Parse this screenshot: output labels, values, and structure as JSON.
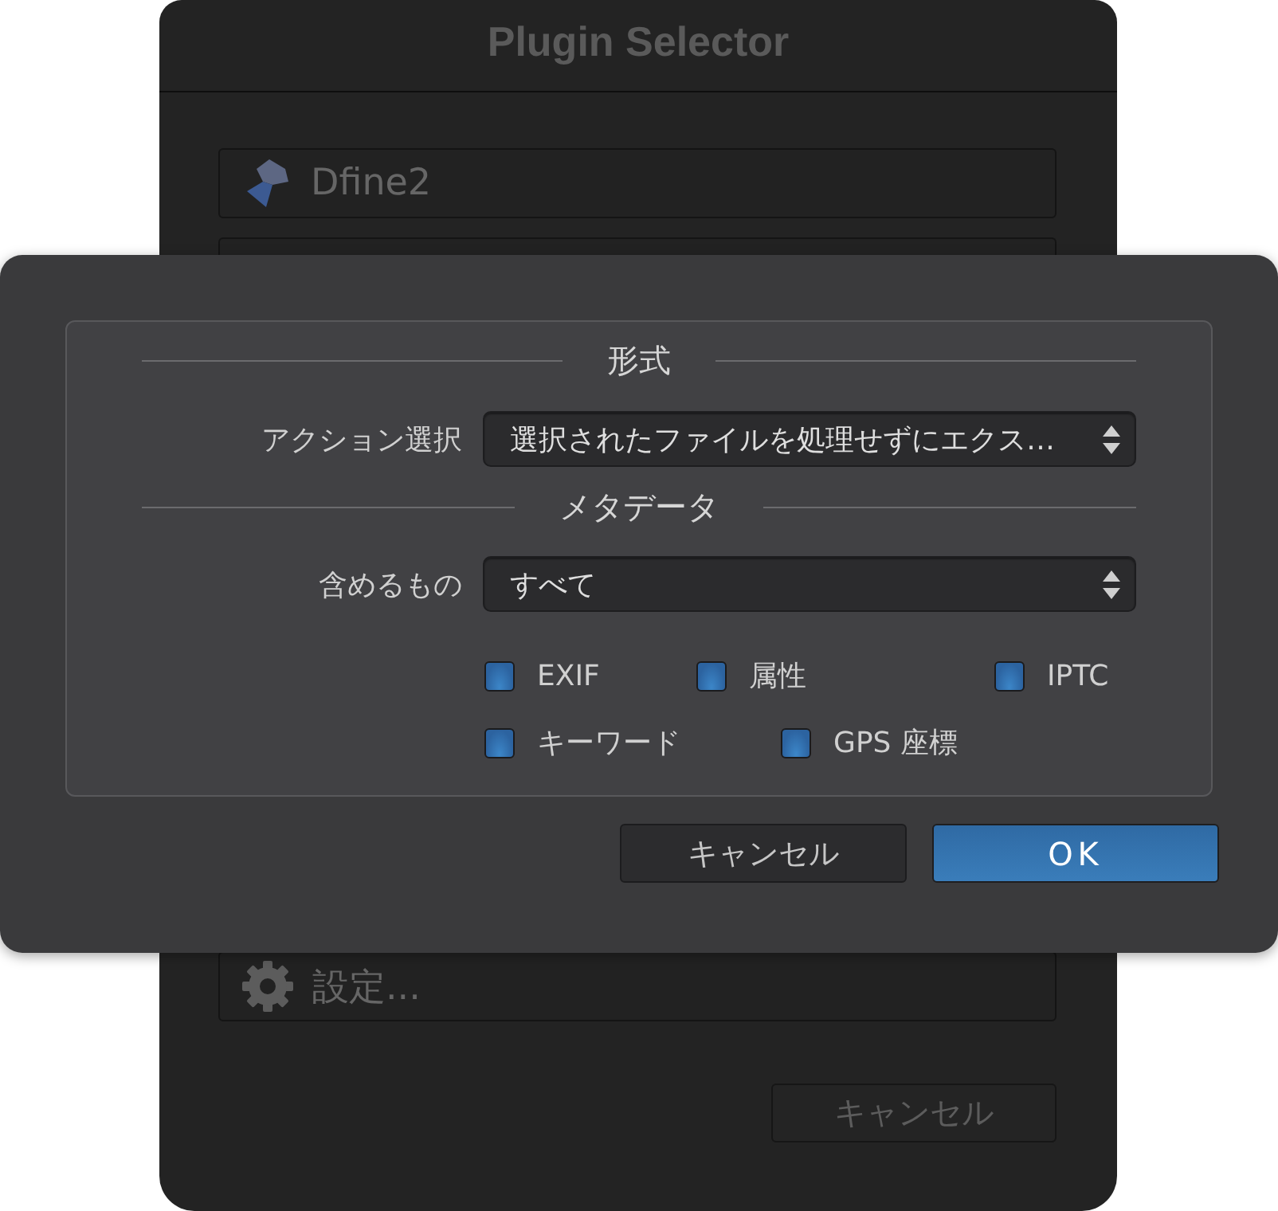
{
  "window": {
    "title": "Plugin Selector",
    "plugins": [
      {
        "name": "Dfine2"
      }
    ],
    "settings_item": {
      "label": "設定..."
    },
    "cancel_button": {
      "label": "キャンセル"
    }
  },
  "sheet": {
    "sections": [
      {
        "title": "形式",
        "fields": [
          {
            "label": "アクション選択",
            "value": "選択されたファイルを処理せずにエクス…"
          }
        ]
      },
      {
        "title": "メタデータ",
        "fields": [
          {
            "label": "含めるもの",
            "value": "すべて"
          }
        ],
        "checkbox_rows": [
          [
            {
              "label": "EXIF",
              "checked": true
            },
            {
              "label": "属性",
              "checked": true
            },
            {
              "label": "IPTC",
              "checked": true
            }
          ],
          [
            {
              "label": "キーワード",
              "checked": true
            },
            {
              "label": "GPS 座標",
              "checked": true
            }
          ]
        ]
      }
    ],
    "buttons": [
      {
        "label": "キャンセル",
        "kind": "secondary"
      },
      {
        "label": "OK",
        "kind": "primary"
      }
    ]
  }
}
